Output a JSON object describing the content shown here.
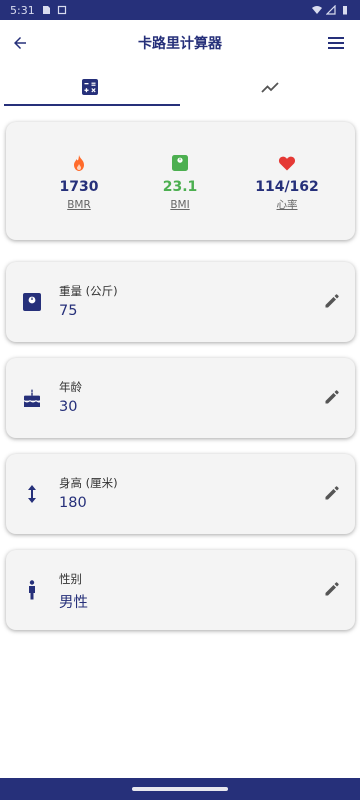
{
  "status_bar": {
    "time": "5:31"
  },
  "app_bar": {
    "title": "卡路里计算器"
  },
  "tabs": [
    {
      "name": "calculator",
      "icon": "calculator-icon",
      "active": true
    },
    {
      "name": "trend",
      "icon": "trending-icon",
      "active": false
    }
  ],
  "stats": [
    {
      "icon": "flame-icon",
      "value": "1730",
      "label": "BMR",
      "color": "#ff6b2b"
    },
    {
      "icon": "scale-icon",
      "value": "23.1",
      "label": "BMI",
      "color": "#4caf50"
    },
    {
      "icon": "heart-icon",
      "value": "114/162",
      "label": "心率",
      "color": "#e53935"
    }
  ],
  "fields": [
    {
      "icon": "scale-weight-icon",
      "label": "重量 (公斤)",
      "value": "75"
    },
    {
      "icon": "cake-icon",
      "label": "年龄",
      "value": "30"
    },
    {
      "icon": "height-arrows-icon",
      "label": "身高 (厘米)",
      "value": "180"
    },
    {
      "icon": "person-icon",
      "label": "性别",
      "value": "男性"
    }
  ],
  "colors": {
    "primary": "#26307a",
    "bmi": "#4caf50",
    "flame": "#ff6b2b",
    "heart": "#e53935"
  }
}
